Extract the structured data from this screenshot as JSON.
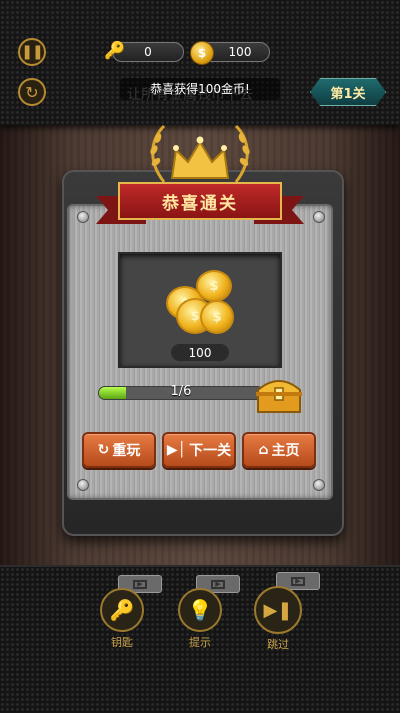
{
  "hud": {
    "keys_count": "0",
    "coins_count": "100",
    "level_label": "第1关",
    "hint_text": "让所有金属钱币下去",
    "toast": "恭喜获得100金币!"
  },
  "dialog": {
    "title": "恭喜通关",
    "reward_amount": "100",
    "coin_symbol": "$",
    "progress_text": "1/6",
    "progress_fraction": 0.1667,
    "buttons": {
      "replay": "重玩",
      "next": "下一关",
      "home": "主页"
    }
  },
  "tools": {
    "key": "钥匙",
    "hint": "提示",
    "skip": "跳过"
  },
  "icons": [
    "pause-icon",
    "restart-icon",
    "key-icon",
    "coin-icon",
    "crown-icon",
    "treasure-chest-icon",
    "replay-icon",
    "play-next-icon",
    "home-icon",
    "video-icon",
    "lightbulb-icon",
    "skip-icon"
  ],
  "colors": {
    "accent_gold": "#e0a313",
    "ribbon_red": "#c02a2a",
    "button_orange": "#e67b43",
    "progress_green": "#8ad62e",
    "level_teal": "#1f6b6e"
  }
}
